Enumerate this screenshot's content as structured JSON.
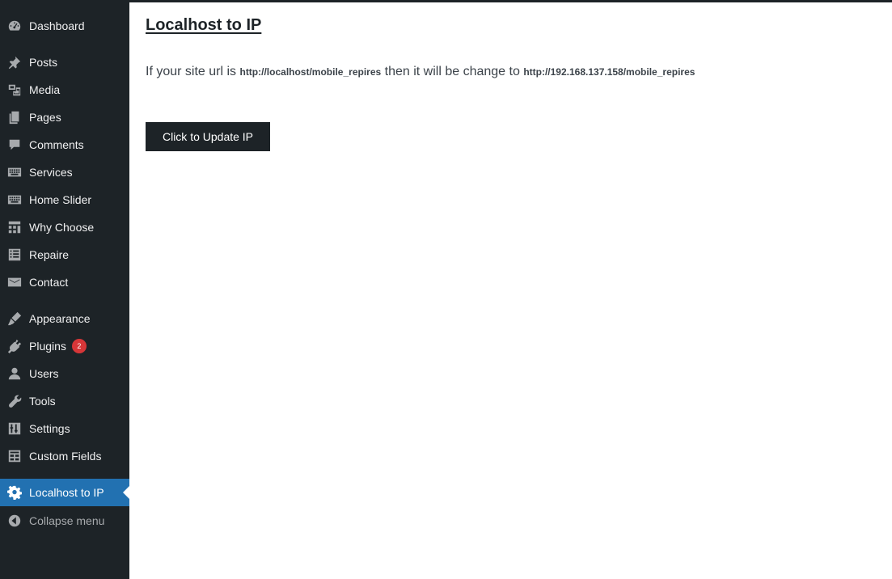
{
  "sidebar": {
    "items": [
      {
        "label": "Dashboard",
        "icon": "dashboard-icon"
      },
      {
        "label": "Posts",
        "icon": "pin-icon"
      },
      {
        "label": "Media",
        "icon": "media-icon"
      },
      {
        "label": "Pages",
        "icon": "pages-icon"
      },
      {
        "label": "Comments",
        "icon": "comment-icon"
      },
      {
        "label": "Services",
        "icon": "keyboard-icon"
      },
      {
        "label": "Home Slider",
        "icon": "keyboard-icon"
      },
      {
        "label": "Why Choose",
        "icon": "layout-icon"
      },
      {
        "label": "Repaire",
        "icon": "list-icon"
      },
      {
        "label": "Contact",
        "icon": "envelope-icon"
      },
      {
        "label": "Appearance",
        "icon": "brush-icon"
      },
      {
        "label": "Plugins",
        "icon": "plug-icon",
        "badge": "2"
      },
      {
        "label": "Users",
        "icon": "user-icon"
      },
      {
        "label": "Tools",
        "icon": "wrench-icon"
      },
      {
        "label": "Settings",
        "icon": "sliders-icon"
      },
      {
        "label": "Custom Fields",
        "icon": "table-icon"
      },
      {
        "label": "Localhost to IP",
        "icon": "gear-icon",
        "active": true
      },
      {
        "label": "Collapse menu",
        "icon": "collapse-icon"
      }
    ]
  },
  "main": {
    "title": "Localhost to IP",
    "desc_prefix": "If your site url is",
    "url_local": "http://localhost/mobile_repires",
    "desc_middle": "then it will be change to",
    "url_ip": "http://192.168.137.158/mobile_repires",
    "button_label": "Click to Update IP"
  },
  "colors": {
    "sidebar_bg": "#1d2327",
    "active_bg": "#2271b1",
    "badge_bg": "#d63638",
    "button_bg": "#1d2327"
  }
}
